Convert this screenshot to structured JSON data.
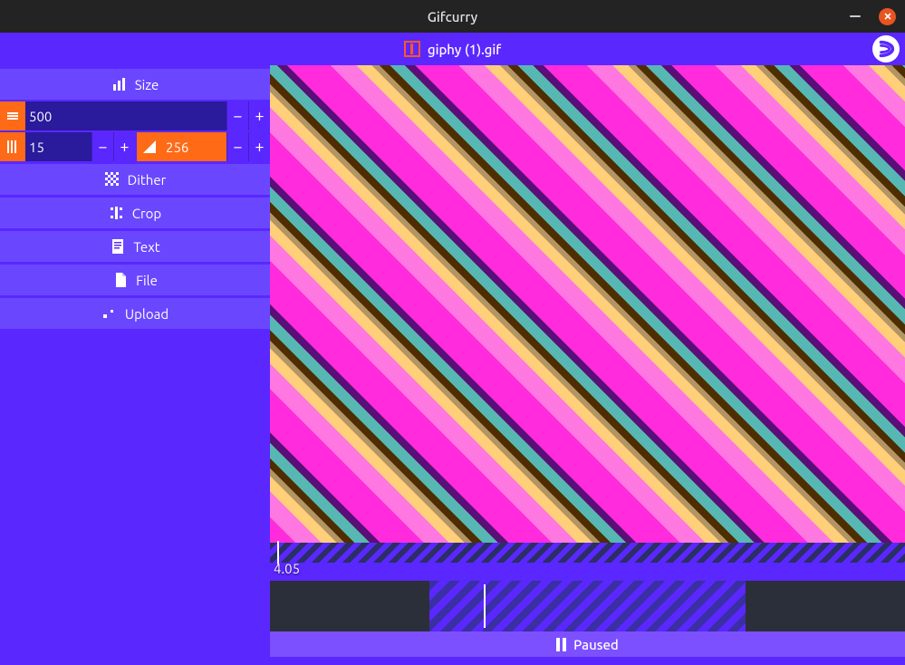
{
  "window": {
    "title": "Gifcurry"
  },
  "header": {
    "filename": "giphy (1).gif"
  },
  "sidebar": {
    "tabs": {
      "size": "Size",
      "dither": "Dither",
      "crop": "Crop",
      "text": "Text",
      "file": "File",
      "upload": "Upload"
    },
    "size_panel": {
      "width_value": "500",
      "fps_value": "15",
      "colors_value": "256"
    }
  },
  "timeline": {
    "time_label": "4.05"
  },
  "status": {
    "text": "Paused"
  }
}
